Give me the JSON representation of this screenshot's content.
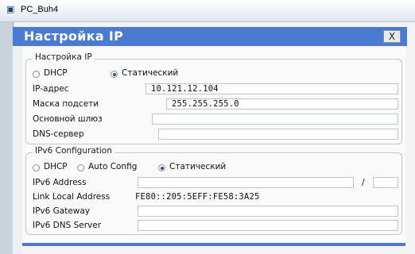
{
  "window": {
    "os_title": "PC_Buh4",
    "dialog_title": "Настройка IP",
    "close_label": "X"
  },
  "ipv4": {
    "legend": "Настройка IP",
    "dhcp_label": "DHCP",
    "static_label": "Статический",
    "selected_mode": "static",
    "ip_label": "IP-адрес",
    "ip_value": "10.121.12.104",
    "mask_label": "Маска подсети",
    "mask_value": "255.255.255.0",
    "gateway_label": "Основной шлюз",
    "gateway_value": "",
    "dns_label": "DNS-сервер",
    "dns_value": ""
  },
  "ipv6": {
    "legend": "IPv6 Configuration",
    "dhcp_label": "DHCP",
    "auto_label": "Auto Config",
    "static_label": "Статический",
    "selected_mode": "static",
    "address_label": "IPv6 Address",
    "address_value": "",
    "prefix_separator": "/",
    "prefix_value": "",
    "link_local_label": "Link Local Address",
    "link_local_value": "FE80::205:5EFF:FE58:3A25",
    "gateway_label": "IPv6 Gateway",
    "gateway_value": "",
    "dns_label": "IPv6 DNS Server",
    "dns_value": ""
  },
  "colors": {
    "header_blue": "#4a7bd0"
  }
}
